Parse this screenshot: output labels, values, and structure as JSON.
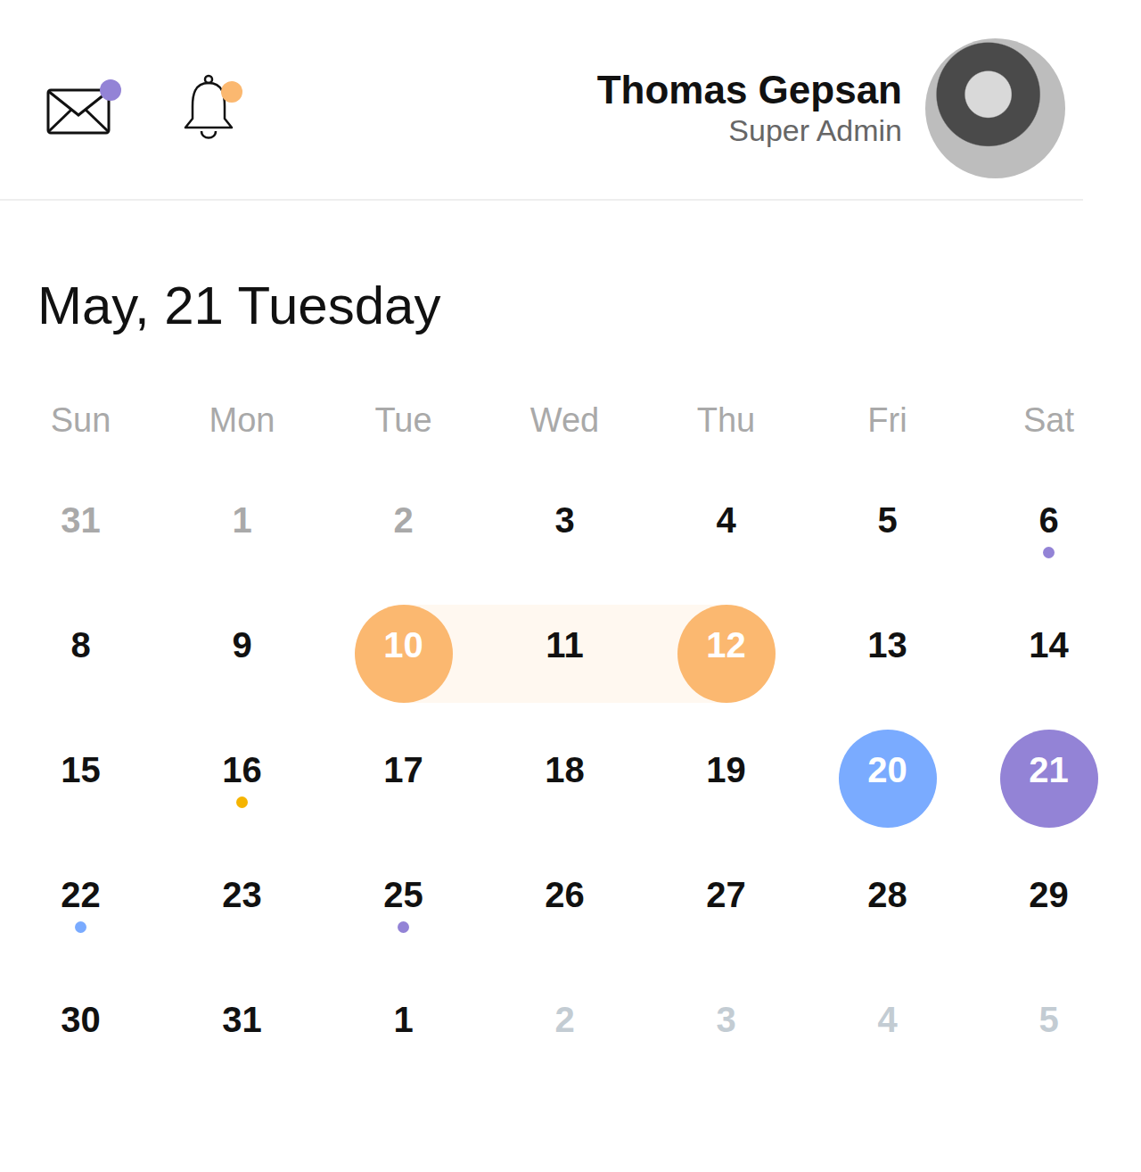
{
  "header": {
    "mail_unread": true,
    "bell_unread": true
  },
  "user": {
    "name": "Thomas Gepsan",
    "role": "Super Admin"
  },
  "date_title": "May, 21 Tuesday",
  "weekdays": [
    "Sun",
    "Mon",
    "Tue",
    "Wed",
    "Thu",
    "Fri",
    "Sat"
  ],
  "weeks": [
    [
      {
        "label": "31",
        "kind": "outside"
      },
      {
        "label": "1",
        "kind": "outside"
      },
      {
        "label": "2",
        "kind": "outside"
      },
      {
        "label": "3",
        "kind": "plain"
      },
      {
        "label": "4",
        "kind": "plain"
      },
      {
        "label": "5",
        "kind": "plain"
      },
      {
        "label": "6",
        "kind": "plain",
        "dot": "#9383d6"
      }
    ],
    [
      {
        "label": "8",
        "kind": "plain"
      },
      {
        "label": "9",
        "kind": "plain"
      },
      {
        "label": "10",
        "kind": "range-start",
        "color": "#fbb870"
      },
      {
        "label": "11",
        "kind": "range-middle"
      },
      {
        "label": "12",
        "kind": "range-end",
        "color": "#fbb870"
      },
      {
        "label": "13",
        "kind": "plain"
      },
      {
        "label": "14",
        "kind": "plain"
      }
    ],
    [
      {
        "label": "15",
        "kind": "plain"
      },
      {
        "label": "16",
        "kind": "plain",
        "dot": "#f5b400"
      },
      {
        "label": "17",
        "kind": "plain"
      },
      {
        "label": "18",
        "kind": "plain"
      },
      {
        "label": "19",
        "kind": "plain"
      },
      {
        "label": "20",
        "kind": "circle",
        "color": "#7aabff"
      },
      {
        "label": "21",
        "kind": "circle",
        "color": "#9383d6"
      }
    ],
    [
      {
        "label": "22",
        "kind": "plain",
        "dot": "#7aabff"
      },
      {
        "label": "23",
        "kind": "plain"
      },
      {
        "label": "25",
        "kind": "plain",
        "dot": "#9383d6"
      },
      {
        "label": "26",
        "kind": "plain"
      },
      {
        "label": "27",
        "kind": "plain"
      },
      {
        "label": "28",
        "kind": "plain"
      },
      {
        "label": "29",
        "kind": "plain"
      }
    ],
    [
      {
        "label": "30",
        "kind": "plain"
      },
      {
        "label": "31",
        "kind": "plain"
      },
      {
        "label": "1",
        "kind": "plain"
      },
      {
        "label": "2",
        "kind": "faded"
      },
      {
        "label": "3",
        "kind": "faded"
      },
      {
        "label": "4",
        "kind": "faded"
      },
      {
        "label": "5",
        "kind": "faded"
      }
    ]
  ]
}
